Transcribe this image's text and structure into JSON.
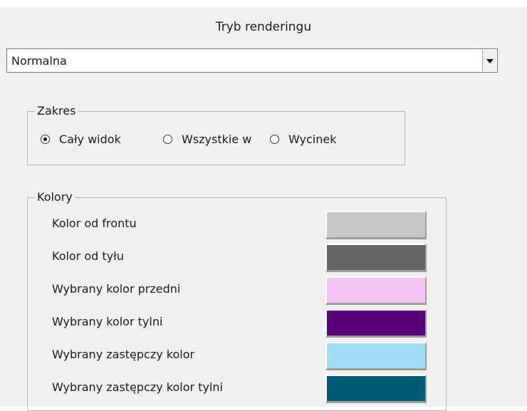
{
  "dialog": {
    "title": "Tryb renderingu"
  },
  "render_mode": {
    "selected": "Normalna"
  },
  "range": {
    "legend": "Zakres",
    "options": [
      {
        "label": "Cały widok",
        "selected": true
      },
      {
        "label": "Wszystkie w",
        "selected": false
      },
      {
        "label": "Wycinek",
        "selected": false
      }
    ]
  },
  "colors": {
    "legend": "Kolory",
    "rows": [
      {
        "label": "Kolor od frontu",
        "swatch": "#c8c8c8"
      },
      {
        "label": "Kolor od tyłu",
        "swatch": "#646464"
      },
      {
        "label": "Wybrany kolor przedni",
        "swatch": "#f5c2f5"
      },
      {
        "label": "Wybrany kolor tylni",
        "swatch": "#5a0078"
      },
      {
        "label": "Wybrany zastępczy kolor",
        "swatch": "#a0dcf5"
      },
      {
        "label": "Wybrany zastępczy kolor tylni",
        "swatch": "#005a78"
      }
    ]
  },
  "icons": {
    "dropdown": "chevron-down-icon"
  }
}
